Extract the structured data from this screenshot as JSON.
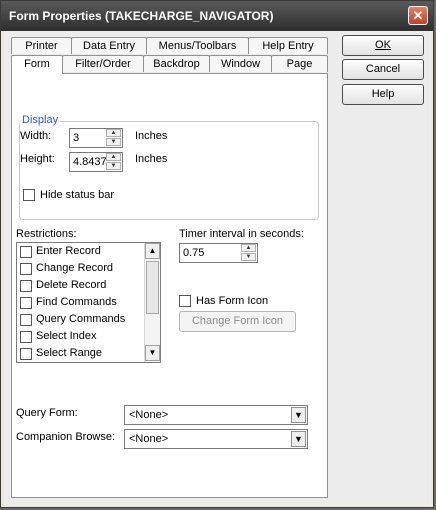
{
  "window": {
    "title": "Form Properties (TAKECHARGE_NAVIGATOR)",
    "close_glyph": "✕"
  },
  "tabs": {
    "row_back": [
      "Printer",
      "Data Entry",
      "Menus/Toolbars",
      "Help Entry"
    ],
    "row_front": [
      "Form",
      "Filter/Order",
      "Backdrop",
      "Window",
      "Page"
    ],
    "active": "Form"
  },
  "buttons": {
    "ok": "OK",
    "cancel": "Cancel",
    "help": "Help"
  },
  "display": {
    "legend": "Display",
    "width_label": "Width:",
    "width_value": "3",
    "width_unit": "Inches",
    "height_label": "Height:",
    "height_value": "4.8437",
    "height_unit": "Inches",
    "hide_status_bar": "Hide status bar"
  },
  "restrictions": {
    "label": "Restrictions:",
    "items": [
      "Enter Record",
      "Change Record",
      "Delete Record",
      "Find Commands",
      "Query Commands",
      "Select Index",
      "Select Range"
    ]
  },
  "timer": {
    "label": "Timer interval in seconds:",
    "value": "0.75"
  },
  "form_icon": {
    "has_label": "Has Form Icon",
    "change_button": "Change Form Icon"
  },
  "query_form": {
    "label": "Query Form:",
    "value": "<None>"
  },
  "companion_browse": {
    "label": "Companion Browse:",
    "value": "<None>"
  },
  "colors": {
    "accent": "#2a5fc2",
    "titlebar": "#3a3a3a",
    "close": "#c0412a"
  }
}
